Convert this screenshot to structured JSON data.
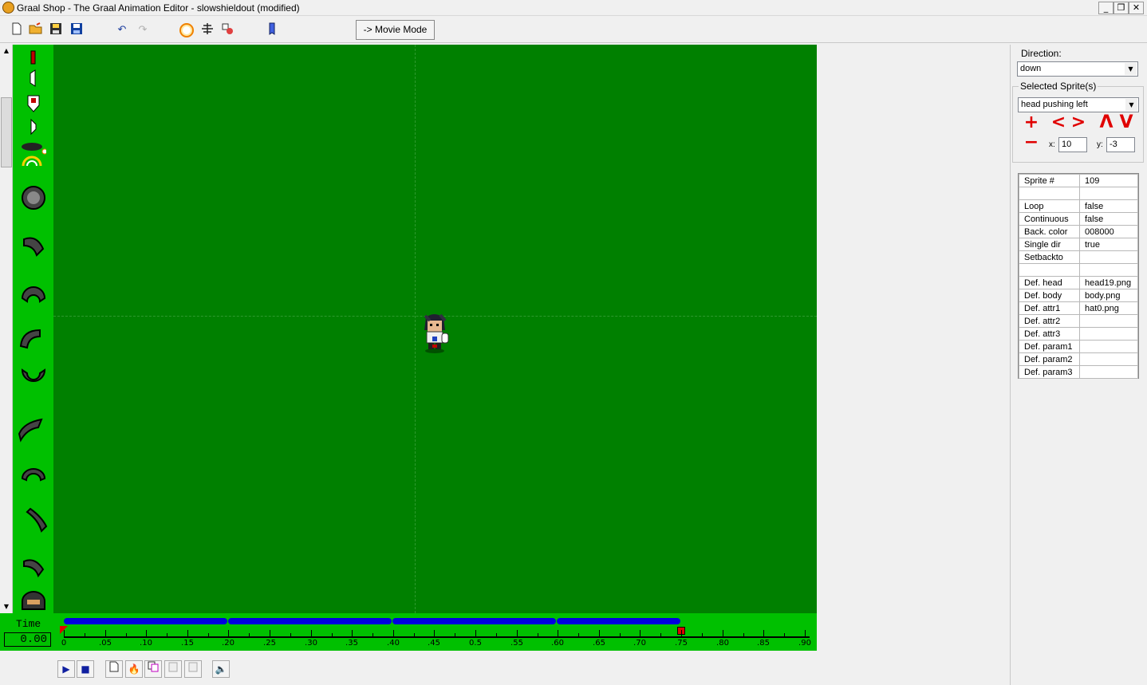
{
  "window": {
    "title": "Graal Shop - The Graal Animation Editor - slowshieldout (modified)",
    "minimize": "_",
    "restore": "❐",
    "close": "✕"
  },
  "toolbar": {
    "movie_mode": "-> Movie Mode"
  },
  "timeline": {
    "time_label": "Time",
    "time_value": "0.00",
    "ticks": [
      "0",
      ".05",
      ".10",
      ".15",
      ".20",
      ".25",
      ".30",
      ".35",
      ".40",
      ".45",
      "0.5",
      ".55",
      ".60",
      ".65",
      ".70",
      ".75",
      ".80",
      ".85",
      ".90"
    ]
  },
  "panel": {
    "direction_label": "Direction:",
    "direction_value": "down",
    "selected_label": "Selected Sprite(s)",
    "selected_value": "head pushing left",
    "x_label": "x:",
    "x_value": "10",
    "y_label": "y:",
    "y_value": "-3"
  },
  "properties": [
    {
      "key": "Sprite #",
      "value": "109"
    },
    {
      "key": "",
      "value": ""
    },
    {
      "key": "Loop",
      "value": "false"
    },
    {
      "key": "Continuous",
      "value": "false"
    },
    {
      "key": "Back. color",
      "value": "008000"
    },
    {
      "key": "Single dir",
      "value": "true"
    },
    {
      "key": "Setbackto",
      "value": ""
    },
    {
      "key": "",
      "value": ""
    },
    {
      "key": "Def. head",
      "value": "head19.png"
    },
    {
      "key": "Def. body",
      "value": "body.png"
    },
    {
      "key": "Def. attr1",
      "value": "hat0.png"
    },
    {
      "key": "Def. attr2",
      "value": ""
    },
    {
      "key": "Def. attr3",
      "value": ""
    },
    {
      "key": "Def. param1",
      "value": ""
    },
    {
      "key": "Def. param2",
      "value": ""
    },
    {
      "key": "Def. param3",
      "value": ""
    }
  ],
  "colors": {
    "canvas_bg": "#008000",
    "sidebar_bg": "#00c000",
    "frame_bar": "#0000e0",
    "accent_red": "#e00000"
  }
}
